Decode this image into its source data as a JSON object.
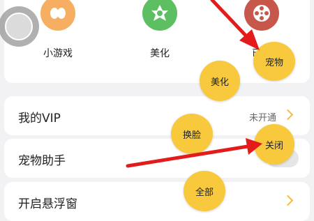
{
  "features": [
    {
      "label": "小游戏",
      "icon": "game-icon",
      "color": "#f5ae62"
    },
    {
      "label": "美化",
      "icon": "flower-icon",
      "color": "#5dbf61"
    },
    {
      "label": "已录",
      "icon": "film-reel-icon",
      "color": "#c7574a"
    }
  ],
  "rows": {
    "vip": {
      "label": "我的VIP",
      "status": "未开通"
    },
    "pet": {
      "label": "宠物助手"
    },
    "float": {
      "label": "开启悬浮窗"
    }
  },
  "menu": {
    "pet": "宠物",
    "beautify": "美化",
    "change_face": "换脸",
    "close": "关闭",
    "all": "全部"
  },
  "annotation_color": "#e31b1b"
}
